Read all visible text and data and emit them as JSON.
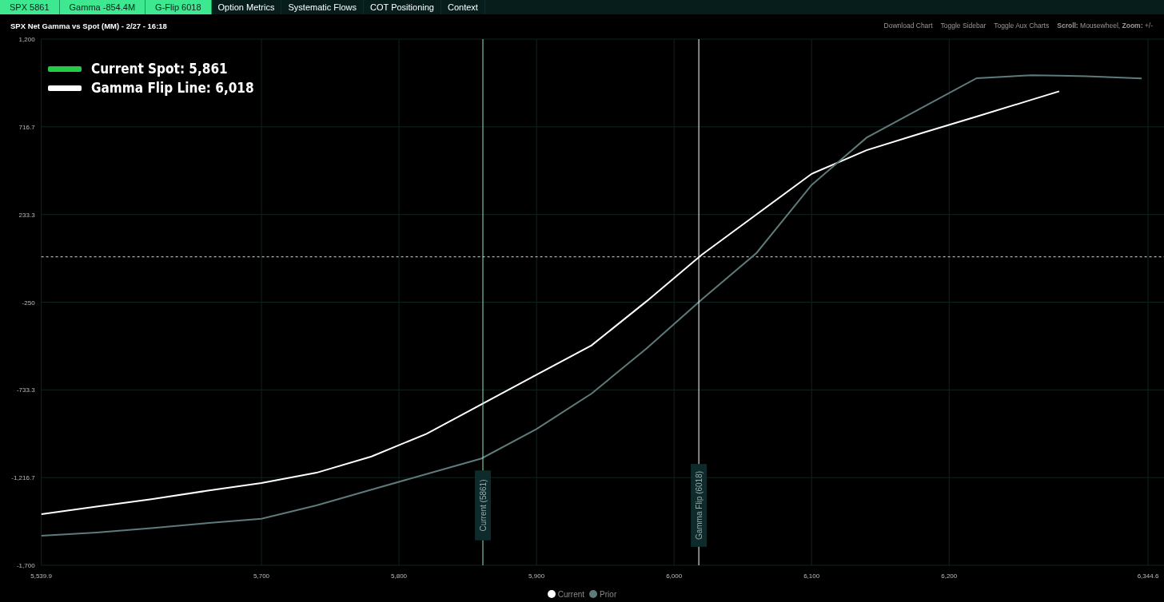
{
  "nav": [
    {
      "label": "SPX 5861",
      "kind": "stat"
    },
    {
      "label": "Gamma -854.4M",
      "kind": "stat"
    },
    {
      "label": "G-Flip 6018",
      "kind": "stat"
    },
    {
      "label": "Option Metrics",
      "kind": "link"
    },
    {
      "label": "Systematic Flows",
      "kind": "link"
    },
    {
      "label": "COT Positioning",
      "kind": "link"
    },
    {
      "label": "Context",
      "kind": "link"
    }
  ],
  "chart_title": "SPX Net Gamma vs Spot (MM) - 2/27 - 16:18",
  "toolbar": [
    {
      "label": "Download Chart",
      "kind": "link"
    },
    {
      "label": "Toggle Sidebar",
      "kind": "link"
    },
    {
      "label": "Toggle Aux Charts",
      "kind": "link"
    },
    {
      "label": "**Scroll:** Mousewheel, **Zoom:** +/-",
      "kind": "hint"
    }
  ],
  "overlay_legend": [
    {
      "label": "Current Spot: 5,861",
      "color": "#22cc44"
    },
    {
      "label": "Gamma Flip Line: 6,018",
      "color": "#ffffff"
    }
  ],
  "chart_data": {
    "type": "line",
    "x": [
      5540,
      5580,
      5620,
      5660,
      5700,
      5740,
      5780,
      5820,
      5860,
      5900,
      5940,
      5980,
      6020,
      6060,
      6100,
      6140,
      6180,
      6220,
      6260,
      6280,
      6300,
      6340
    ],
    "series": [
      {
        "name": "Current",
        "color": "#ffffff",
        "values": [
          -1419,
          -1377,
          -1336,
          -1290,
          -1247,
          -1190,
          -1100,
          -975,
          -813,
          -650,
          -488,
          -245,
          11,
          234,
          457,
          588,
          682,
          773,
          866,
          912,
          null,
          null
        ]
      },
      {
        "name": "Prior",
        "color": "#5f7a7a",
        "values": [
          -1537,
          -1519,
          -1496,
          -1468,
          -1444,
          -1370,
          -1283,
          -1197,
          -1111,
          -949,
          -754,
          -505,
          -236,
          22,
          396,
          657,
          821,
          985,
          1001,
          999,
          996,
          983
        ]
      }
    ],
    "xlim": [
      5539.9,
      6344.6
    ],
    "ylim": [
      -1700,
      1200
    ],
    "xticks": [
      {
        "value": 5539.9,
        "label": "5,539.9"
      },
      {
        "value": 5700,
        "label": "5,700"
      },
      {
        "value": 5800,
        "label": "5,800"
      },
      {
        "value": 5900,
        "label": "5,900"
      },
      {
        "value": 6000,
        "label": "6,000"
      },
      {
        "value": 6100,
        "label": "6,100"
      },
      {
        "value": 6200,
        "label": "6,200"
      },
      {
        "value": 6344.6,
        "label": "6,344.6"
      }
    ],
    "yticks": [
      {
        "value": 1200,
        "label": "1,200"
      },
      {
        "value": 716.7,
        "label": "716.7"
      },
      {
        "value": 233.3,
        "label": "233.3"
      },
      {
        "value": -250,
        "label": "-250"
      },
      {
        "value": -733.3,
        "label": "-733.3"
      },
      {
        "value": -1216.7,
        "label": "-1,216.7"
      },
      {
        "value": -1700,
        "label": "-1,700"
      }
    ],
    "grid": true,
    "legend": true,
    "ref_lines": [
      {
        "axis": "x",
        "value": 5861,
        "label": "Current (5861)",
        "color": "#8ee8c0"
      },
      {
        "axis": "x",
        "value": 6018,
        "label": "Gamma Flip (6018)",
        "color": "#ffffff"
      },
      {
        "axis": "y",
        "value": 0,
        "color": "#dddddd"
      }
    ]
  }
}
